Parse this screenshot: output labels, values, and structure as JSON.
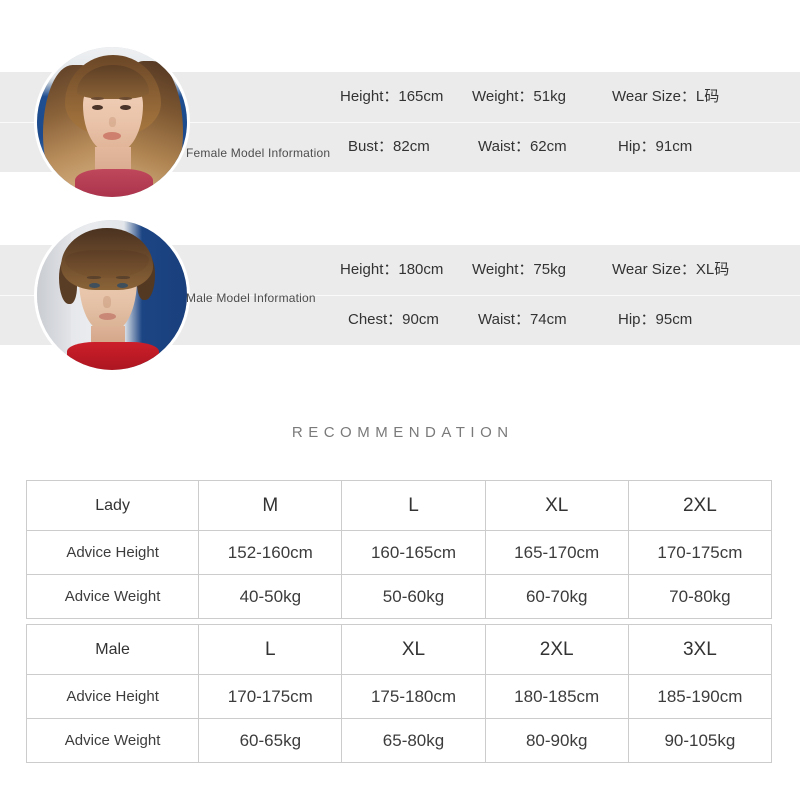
{
  "models": [
    {
      "id": "female",
      "caption": "Female Model Information",
      "avatar_icon": "female-model-avatar",
      "rows": [
        [
          {
            "label": "Height",
            "sep": "：",
            "value": "165cm"
          },
          {
            "label": "Weight",
            "sep": "：",
            "value": "51kg"
          },
          {
            "label": "Wear Size",
            "sep": "：",
            "value": "L码"
          }
        ],
        [
          {
            "label": "Bust",
            "sep": "：",
            "value": "82cm"
          },
          {
            "label": "Waist",
            "sep": "：",
            "value": "62cm"
          },
          {
            "label": "Hip",
            "sep": "：",
            "value": "91cm"
          }
        ]
      ]
    },
    {
      "id": "male",
      "caption": "Male Model Information",
      "avatar_icon": "male-model-avatar",
      "rows": [
        [
          {
            "label": "Height",
            "sep": "：",
            "value": "180cm"
          },
          {
            "label": "Weight",
            "sep": "：",
            "value": "75kg"
          },
          {
            "label": "Wear Size",
            "sep": "：",
            "value": "XL码"
          }
        ],
        [
          {
            "label": "Chest",
            "sep": "：",
            "value": "90cm"
          },
          {
            "label": "Waist",
            "sep": "：",
            "value": "74cm"
          },
          {
            "label": "Hip",
            "sep": "：",
            "value": "95cm"
          }
        ]
      ]
    }
  ],
  "female_cells": {
    "r1c1": "Height：165cm",
    "r1c2": "Weight：51kg",
    "r1c3": "Wear Size：L码",
    "r2c1": "Bust：82cm",
    "r2c2": "Waist：62cm",
    "r2c3": "Hip：91cm"
  },
  "male_cells": {
    "r1c1": "Height：180cm",
    "r1c2": "Weight：75kg",
    "r1c3": "Wear Size：XL码",
    "r2c1": "Chest：90cm",
    "r2c2": "Waist：74cm",
    "r2c3": "Hip：95cm"
  },
  "recommendation_heading": "RECOMMENDATION",
  "lady_table": {
    "header": [
      "Lady",
      "M",
      "L",
      "XL",
      "2XL"
    ],
    "rows": [
      {
        "label": "Advice Height",
        "values": [
          "152-160cm",
          "160-165cm",
          "165-170cm",
          "170-175cm"
        ]
      },
      {
        "label": "Advice Weight",
        "values": [
          "40-50kg",
          "50-60kg",
          "60-70kg",
          "70-80kg"
        ]
      }
    ]
  },
  "male_table": {
    "header": [
      "Male",
      "L",
      "XL",
      "2XL",
      "3XL"
    ],
    "rows": [
      {
        "label": "Advice Height",
        "values": [
          "170-175cm",
          "175-180cm",
          "180-185cm",
          "185-190cm"
        ]
      },
      {
        "label": "Advice Weight",
        "values": [
          "60-65kg",
          "65-80kg",
          "80-90kg",
          "90-105kg"
        ]
      }
    ]
  },
  "colors": {
    "page_background": "#ffffff",
    "info_band": "#ebebeb",
    "table_border": "#cccccc",
    "text_primary": "#333333",
    "heading_gray": "#7a7a7a"
  }
}
